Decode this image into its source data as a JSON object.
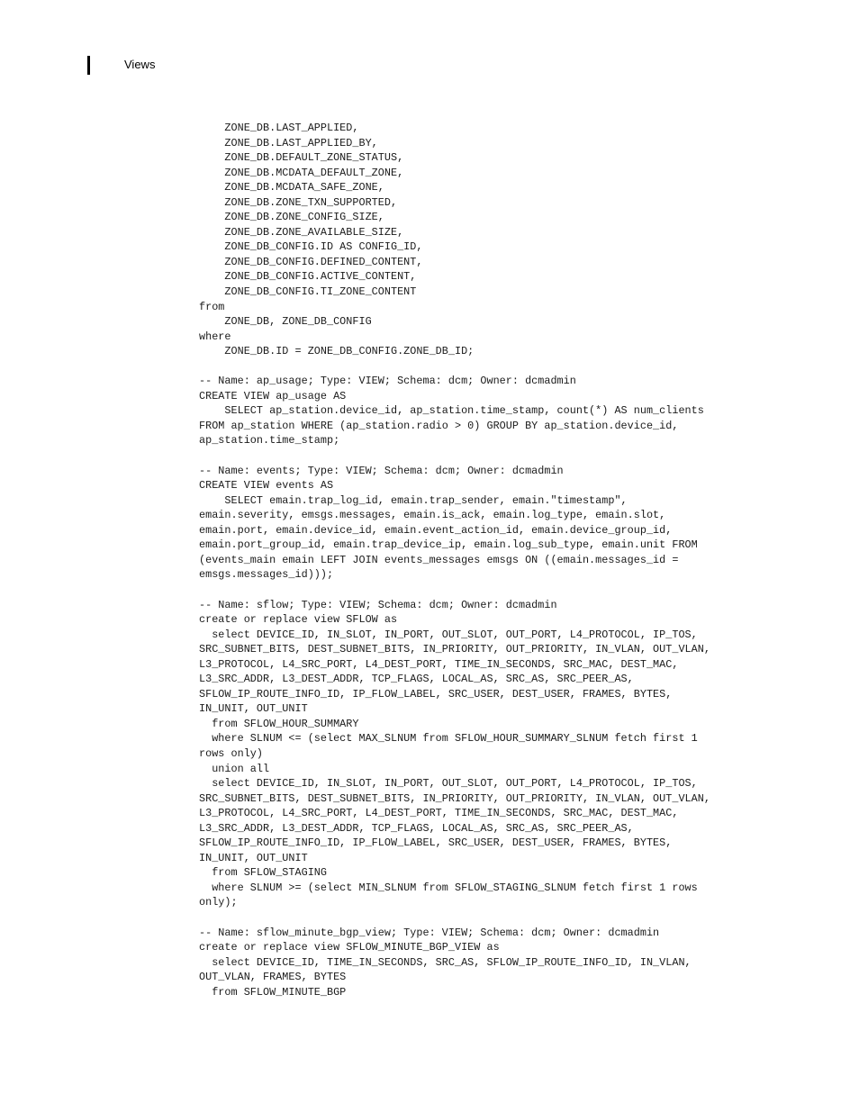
{
  "header": {
    "title": "Views",
    "rule_marker": "vertical-bar"
  },
  "document": {
    "code_lines": [
      "    ZONE_DB.LAST_APPLIED,",
      "    ZONE_DB.LAST_APPLIED_BY,",
      "    ZONE_DB.DEFAULT_ZONE_STATUS,",
      "    ZONE_DB.MCDATA_DEFAULT_ZONE,",
      "    ZONE_DB.MCDATA_SAFE_ZONE,",
      "    ZONE_DB.ZONE_TXN_SUPPORTED,",
      "    ZONE_DB.ZONE_CONFIG_SIZE,",
      "    ZONE_DB.ZONE_AVAILABLE_SIZE,",
      "    ZONE_DB_CONFIG.ID AS CONFIG_ID,",
      "    ZONE_DB_CONFIG.DEFINED_CONTENT,",
      "    ZONE_DB_CONFIG.ACTIVE_CONTENT,",
      "    ZONE_DB_CONFIG.TI_ZONE_CONTENT",
      "from",
      "    ZONE_DB, ZONE_DB_CONFIG",
      "where",
      "    ZONE_DB.ID = ZONE_DB_CONFIG.ZONE_DB_ID;",
      "",
      "-- Name: ap_usage; Type: VIEW; Schema: dcm; Owner: dcmadmin",
      "CREATE VIEW ap_usage AS",
      "    SELECT ap_station.device_id, ap_station.time_stamp, count(*) AS num_clients",
      "FROM ap_station WHERE (ap_station.radio > 0) GROUP BY ap_station.device_id,",
      "ap_station.time_stamp;",
      "",
      "-- Name: events; Type: VIEW; Schema: dcm; Owner: dcmadmin",
      "CREATE VIEW events AS",
      "    SELECT emain.trap_log_id, emain.trap_sender, emain.\"timestamp\",",
      "emain.severity, emsgs.messages, emain.is_ack, emain.log_type, emain.slot,",
      "emain.port, emain.device_id, emain.event_action_id, emain.device_group_id,",
      "emain.port_group_id, emain.trap_device_ip, emain.log_sub_type, emain.unit FROM",
      "(events_main emain LEFT JOIN events_messages emsgs ON ((emain.messages_id =",
      "emsgs.messages_id)));",
      "",
      "-- Name: sflow; Type: VIEW; Schema: dcm; Owner: dcmadmin",
      "create or replace view SFLOW as",
      "  select DEVICE_ID, IN_SLOT, IN_PORT, OUT_SLOT, OUT_PORT, L4_PROTOCOL, IP_TOS,",
      "SRC_SUBNET_BITS, DEST_SUBNET_BITS, IN_PRIORITY, OUT_PRIORITY, IN_VLAN, OUT_VLAN,",
      "L3_PROTOCOL, L4_SRC_PORT, L4_DEST_PORT, TIME_IN_SECONDS, SRC_MAC, DEST_MAC,",
      "L3_SRC_ADDR, L3_DEST_ADDR, TCP_FLAGS, LOCAL_AS, SRC_AS, SRC_PEER_AS,",
      "SFLOW_IP_ROUTE_INFO_ID, IP_FLOW_LABEL, SRC_USER, DEST_USER, FRAMES, BYTES,",
      "IN_UNIT, OUT_UNIT",
      "  from SFLOW_HOUR_SUMMARY",
      "  where SLNUM <= (select MAX_SLNUM from SFLOW_HOUR_SUMMARY_SLNUM fetch first 1",
      "rows only)",
      "  union all",
      "  select DEVICE_ID, IN_SLOT, IN_PORT, OUT_SLOT, OUT_PORT, L4_PROTOCOL, IP_TOS,",
      "SRC_SUBNET_BITS, DEST_SUBNET_BITS, IN_PRIORITY, OUT_PRIORITY, IN_VLAN, OUT_VLAN,",
      "L3_PROTOCOL, L4_SRC_PORT, L4_DEST_PORT, TIME_IN_SECONDS, SRC_MAC, DEST_MAC,",
      "L3_SRC_ADDR, L3_DEST_ADDR, TCP_FLAGS, LOCAL_AS, SRC_AS, SRC_PEER_AS,",
      "SFLOW_IP_ROUTE_INFO_ID, IP_FLOW_LABEL, SRC_USER, DEST_USER, FRAMES, BYTES,",
      "IN_UNIT, OUT_UNIT",
      "  from SFLOW_STAGING",
      "  where SLNUM >= (select MIN_SLNUM from SFLOW_STAGING_SLNUM fetch first 1 rows",
      "only);",
      "",
      "-- Name: sflow_minute_bgp_view; Type: VIEW; Schema: dcm; Owner: dcmadmin",
      "create or replace view SFLOW_MINUTE_BGP_VIEW as",
      "  select DEVICE_ID, TIME_IN_SECONDS, SRC_AS, SFLOW_IP_ROUTE_INFO_ID, IN_VLAN,",
      "OUT_VLAN, FRAMES, BYTES",
      "  from SFLOW_MINUTE_BGP"
    ]
  }
}
